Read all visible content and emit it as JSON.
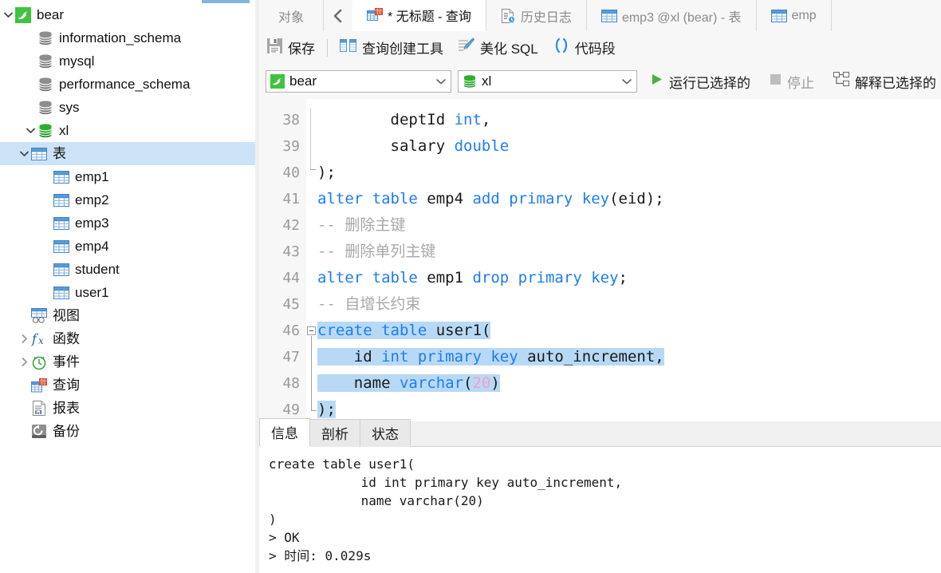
{
  "sidebar": {
    "items": [
      {
        "label": "bear",
        "icon": "mysql-dolphin-icon",
        "level": 0,
        "twisty": "down",
        "type": "connection",
        "selected": false
      },
      {
        "label": "information_schema",
        "icon": "database-gray-icon",
        "level": 1,
        "twisty": "none",
        "type": "database",
        "selected": false
      },
      {
        "label": "mysql",
        "icon": "database-gray-icon",
        "level": 1,
        "twisty": "none",
        "type": "database",
        "selected": false
      },
      {
        "label": "performance_schema",
        "icon": "database-gray-icon",
        "level": 1,
        "twisty": "none",
        "type": "database",
        "selected": false
      },
      {
        "label": "sys",
        "icon": "database-gray-icon",
        "level": 1,
        "twisty": "none",
        "type": "database",
        "selected": false
      },
      {
        "label": "xl",
        "icon": "database-green-icon",
        "level": 1,
        "twisty": "down",
        "type": "database",
        "selected": false
      },
      {
        "label": "表",
        "icon": "table-folder-icon",
        "level": 2,
        "twisty": "down",
        "type": "folder",
        "selected": true
      },
      {
        "label": "emp1",
        "icon": "table-icon",
        "level": 3,
        "twisty": "none",
        "type": "table",
        "selected": false
      },
      {
        "label": "emp2",
        "icon": "table-icon",
        "level": 3,
        "twisty": "none",
        "type": "table",
        "selected": false
      },
      {
        "label": "emp3",
        "icon": "table-icon",
        "level": 3,
        "twisty": "none",
        "type": "table",
        "selected": false
      },
      {
        "label": "emp4",
        "icon": "table-icon",
        "level": 3,
        "twisty": "none",
        "type": "table",
        "selected": false
      },
      {
        "label": "student",
        "icon": "table-icon",
        "level": 3,
        "twisty": "none",
        "type": "table",
        "selected": false
      },
      {
        "label": "user1",
        "icon": "table-icon",
        "level": 3,
        "twisty": "none",
        "type": "table",
        "selected": false
      },
      {
        "label": "视图",
        "icon": "view-icon",
        "level": 2,
        "twisty": "none",
        "type": "folder",
        "selected": false
      },
      {
        "label": "函数",
        "icon": "function-icon",
        "level": 2,
        "twisty": "right",
        "type": "folder",
        "selected": false
      },
      {
        "label": "事件",
        "icon": "event-clock-icon",
        "level": 2,
        "twisty": "right",
        "type": "folder",
        "selected": false
      },
      {
        "label": "查询",
        "icon": "query-icon",
        "level": 2,
        "twisty": "none",
        "type": "folder",
        "selected": false
      },
      {
        "label": "报表",
        "icon": "report-icon",
        "level": 2,
        "twisty": "none",
        "type": "folder",
        "selected": false
      },
      {
        "label": "备份",
        "icon": "backup-icon",
        "level": 2,
        "twisty": "none",
        "type": "folder",
        "selected": false
      }
    ]
  },
  "tabs": {
    "object_label": "对象",
    "back_icon": "chevron-left-icon",
    "items": [
      {
        "label": "* 无标题 - 查询",
        "icon": "query-icon",
        "active": true,
        "modified": true
      },
      {
        "label": "历史日志",
        "icon": "history-log-icon",
        "active": false,
        "modified": false
      },
      {
        "label": "emp3 @xl (bear) - 表",
        "icon": "table-icon",
        "active": false,
        "modified": false
      },
      {
        "label": "emp",
        "icon": "table-icon",
        "active": false,
        "modified": false
      }
    ]
  },
  "toolbar": {
    "save_label": "保存",
    "query_builder_label": "查询创建工具",
    "beautify_label": "美化 SQL",
    "snippet_label": "代码段"
  },
  "connbar": {
    "connection_value": "bear",
    "database_value": "xl",
    "run_selected_label": "运行已选择的",
    "stop_label": "停止",
    "explain_selected_label": "解释已选择的"
  },
  "editor": {
    "first_line": 38,
    "lines": [
      {
        "no": 38,
        "segments": [
          {
            "t": "        deptId ",
            "c": "plain"
          },
          {
            "t": "int",
            "c": "kw"
          },
          {
            "t": ",",
            "c": "plain"
          }
        ]
      },
      {
        "no": 39,
        "segments": [
          {
            "t": "        salary ",
            "c": "plain"
          },
          {
            "t": "double",
            "c": "kw"
          }
        ]
      },
      {
        "no": 40,
        "segments": [
          {
            "t": ");",
            "c": "plain"
          }
        ]
      },
      {
        "no": 41,
        "segments": [
          {
            "t": "alter table ",
            "c": "kw"
          },
          {
            "t": "emp4 ",
            "c": "plain"
          },
          {
            "t": "add primary key",
            "c": "kw"
          },
          {
            "t": "(eid);",
            "c": "plain"
          }
        ]
      },
      {
        "no": 42,
        "segments": [
          {
            "t": "-- 删除主键",
            "c": "cmt"
          }
        ]
      },
      {
        "no": 43,
        "segments": [
          {
            "t": "-- 删除单列主键",
            "c": "cmt"
          }
        ]
      },
      {
        "no": 44,
        "segments": [
          {
            "t": "alter table ",
            "c": "kw"
          },
          {
            "t": "emp1 ",
            "c": "plain"
          },
          {
            "t": "drop primary key",
            "c": "kw"
          },
          {
            "t": ";",
            "c": "plain"
          }
        ]
      },
      {
        "no": 45,
        "segments": [
          {
            "t": "-- 自增长约束",
            "c": "cmt"
          }
        ]
      },
      {
        "no": 46,
        "segments": [
          {
            "t": "create table ",
            "c": "kw"
          },
          {
            "t": "user1(",
            "c": "plain"
          }
        ],
        "selected": true,
        "fold": "start"
      },
      {
        "no": 47,
        "segments": [
          {
            "t": "    id ",
            "c": "plain"
          },
          {
            "t": "int primary key ",
            "c": "kw"
          },
          {
            "t": "auto_increment,",
            "c": "plain"
          }
        ],
        "selected": true
      },
      {
        "no": 48,
        "segments": [
          {
            "t": "    name ",
            "c": "plain"
          },
          {
            "t": "varchar",
            "c": "kw"
          },
          {
            "t": "(",
            "c": "plain"
          },
          {
            "t": "20",
            "c": "num"
          },
          {
            "t": ")",
            "c": "plain"
          }
        ],
        "selected": true
      },
      {
        "no": 49,
        "segments": [
          {
            "t": ");",
            "c": "plain"
          }
        ],
        "selected": true,
        "fold": "end"
      }
    ]
  },
  "bottom": {
    "tabs": [
      {
        "label": "信息",
        "active": true
      },
      {
        "label": "剖析",
        "active": false
      },
      {
        "label": "状态",
        "active": false
      }
    ],
    "output": [
      "create table user1(",
      "            id int primary key auto_increment,",
      "            name varchar(20)",
      ")",
      "> OK",
      "> 时间: 0.029s"
    ]
  },
  "colors": {
    "selection_blue": "#b8d9f5",
    "tree_selection": "#cce3f7",
    "keyword_blue": "#1d7df2",
    "number_pink": "#f59ec8",
    "comment_gray": "#a8a8a8",
    "run_green": "#4caf3f",
    "mysql_green": "#3ec43e"
  }
}
